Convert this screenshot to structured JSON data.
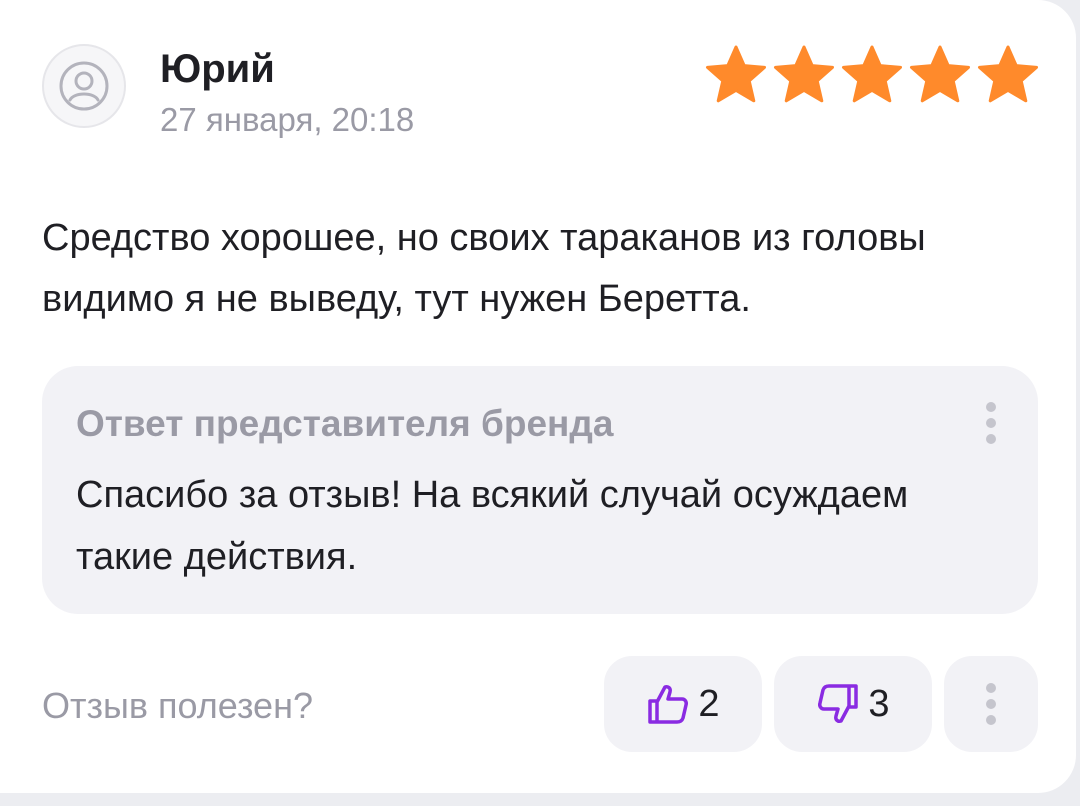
{
  "review": {
    "author": "Юрий",
    "date": "27 января, 20:18",
    "rating": 5,
    "rating_max": 5,
    "text": "Средство хорошее, но своих тараканов из головы видимо я не выведу, тут нужен Беретта."
  },
  "brand_reply": {
    "title": "Ответ представителя бренда",
    "text": "Спасибо за отзыв! На всякий случай осуждаем такие действия."
  },
  "helpful": {
    "question": "Отзыв полезен?",
    "likes": "2",
    "dislikes": "3"
  },
  "icons": {
    "avatar": "user-circle-icon",
    "star": "star-icon",
    "like": "thumbs-up-icon",
    "dislike": "thumbs-down-icon",
    "more": "more-vertical-icon"
  },
  "colors": {
    "star": "#ff8a2b",
    "vote_icon": "#8a2be2",
    "muted_text": "#9a9aa5",
    "reply_bg": "#f2f2f6"
  }
}
